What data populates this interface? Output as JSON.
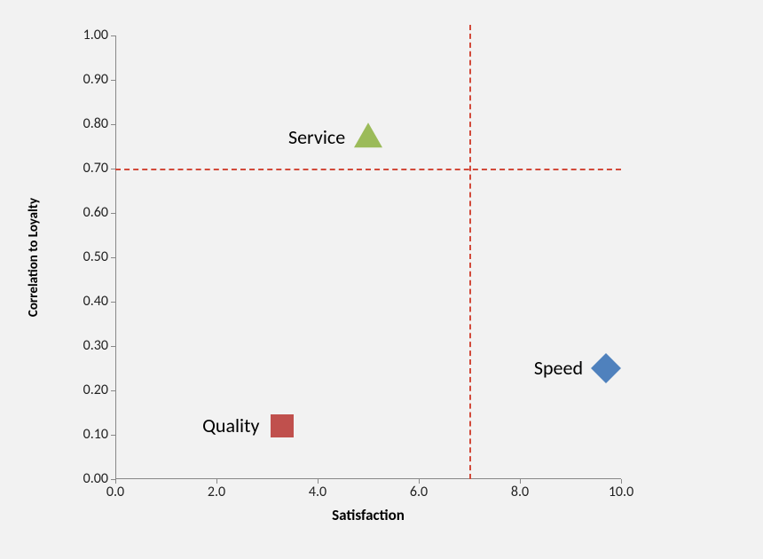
{
  "chart_data": {
    "type": "scatter",
    "xlabel": "Satisfaction",
    "ylabel": "Correlation to Loyalty",
    "xlim": [
      0.0,
      10.0
    ],
    "ylim": [
      0.0,
      1.0
    ],
    "x_ticks": [
      "0.0",
      "2.0",
      "4.0",
      "6.0",
      "8.0",
      "10.0"
    ],
    "y_ticks": [
      "0.00",
      "0.10",
      "0.20",
      "0.30",
      "0.40",
      "0.50",
      "0.60",
      "0.70",
      "0.80",
      "0.90",
      "1.00"
    ],
    "reference_lines": {
      "horizontal_y": 0.7,
      "vertical_x": 7.0
    },
    "points": [
      {
        "name": "Service",
        "x": 5.0,
        "y": 0.77,
        "marker": "triangle",
        "color": "#9bbb59",
        "label_side": "left"
      },
      {
        "name": "Quality",
        "x": 3.3,
        "y": 0.12,
        "marker": "square",
        "color": "#c0504d",
        "label_side": "left"
      },
      {
        "name": "Speed",
        "x": 9.7,
        "y": 0.25,
        "marker": "diamond",
        "color": "#4f81bd",
        "label_side": "left"
      }
    ]
  }
}
